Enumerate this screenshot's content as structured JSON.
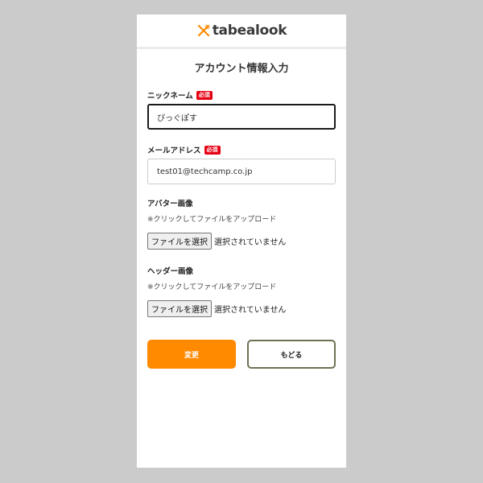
{
  "header": {
    "logo_text": "tabealook",
    "logo_icon": "fork-knife-icon",
    "brand_color": "#ff8a00"
  },
  "form": {
    "title": "アカウント情報入力",
    "nickname": {
      "label": "ニックネーム",
      "required_badge": "必須",
      "value": "ぴっぐぽす"
    },
    "email": {
      "label": "メールアドレス",
      "required_badge": "必須",
      "value": "test01@techcamp.co.jp"
    },
    "avatar": {
      "label": "アバター画像",
      "note": "※クリックしてファイルをアップロード",
      "button_label": "ファイルを選択",
      "status": "選択されていません"
    },
    "header_image": {
      "label": "ヘッダー画像",
      "note": "※クリックしてファイルをアップロード",
      "button_label": "ファイルを選択",
      "status": "選択されていません"
    },
    "submit_label": "変更",
    "back_label": "もどる"
  },
  "colors": {
    "accent": "#ff8a00",
    "required_badge": "#e60012",
    "back_border": "#6b7352"
  }
}
